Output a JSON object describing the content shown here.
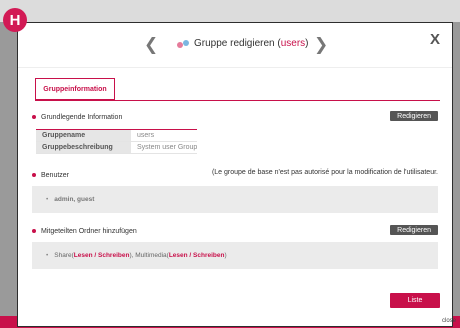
{
  "badge": "H",
  "dialog": {
    "title_prefix": "Gruppe redigieren (",
    "title_group": "users",
    "title_suffix": ")",
    "close_symbol": "X",
    "tab_label": "Gruppeinformation",
    "section_basic": "Grundlegende Information",
    "edit_label": "Redigieren",
    "fields": [
      {
        "label": "Gruppename",
        "value": "users"
      },
      {
        "label": "Gruppebeschreibung",
        "value": "System user Group"
      }
    ],
    "section_users": "Benutzer",
    "users_note": "(Le groupe de base n'est pas autorisé pour la modification de l'utilisateur.",
    "users_value": "admin, guest",
    "section_shared": "Mitgeteilten Ordner hinzufügen",
    "shared": {
      "item1": "Share(",
      "perm_read": "Lesen",
      "slash": " / ",
      "perm_write": "Schreiben",
      "sep": "), Multimedia(",
      "end": ")"
    },
    "list_button": "Liste"
  },
  "footer": {
    "close_label": "close"
  },
  "colors": {
    "accent": "#c8104a",
    "header_gray": "#555555"
  }
}
